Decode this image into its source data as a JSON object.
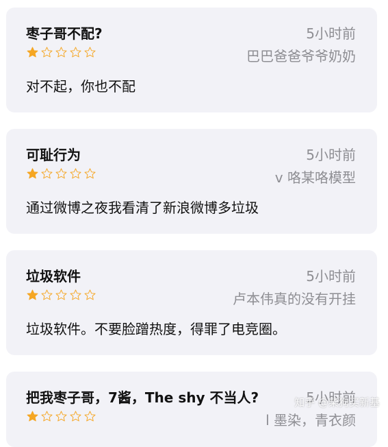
{
  "reviews": [
    {
      "title": "枣子哥不配?",
      "time": "5小时前",
      "author": "巴巴爸爸爷爷奶奶",
      "rating": 1,
      "max_rating": 5,
      "body": "对不起，你也不配"
    },
    {
      "title": "可耻行为",
      "time": "5小时前",
      "author": "v 咯某咯模型",
      "rating": 1,
      "max_rating": 5,
      "body": "通过微博之夜我看清了新浪微博多垃圾"
    },
    {
      "title": "垃圾软件",
      "time": "5小时前",
      "author": "卢本伟真的没有开挂",
      "rating": 1,
      "max_rating": 5,
      "body": "垃圾软件。不要脸蹭热度，得罪了电竞圈。"
    },
    {
      "title": "把我枣子哥，7酱，The shy 不当人?",
      "time": "5小时前",
      "author": "l 墨染，青衣颜",
      "rating": 1,
      "max_rating": 5,
      "body": ""
    }
  ],
  "watermark": "知乎 @柴狗买新基",
  "colors": {
    "card_background": "#f2f2f7",
    "star_color": "#f5a623",
    "secondary_text": "#8e8e93",
    "primary_text": "#111111"
  },
  "icons": {
    "filled_star": "star-filled-icon",
    "empty_star": "star-outline-icon"
  }
}
